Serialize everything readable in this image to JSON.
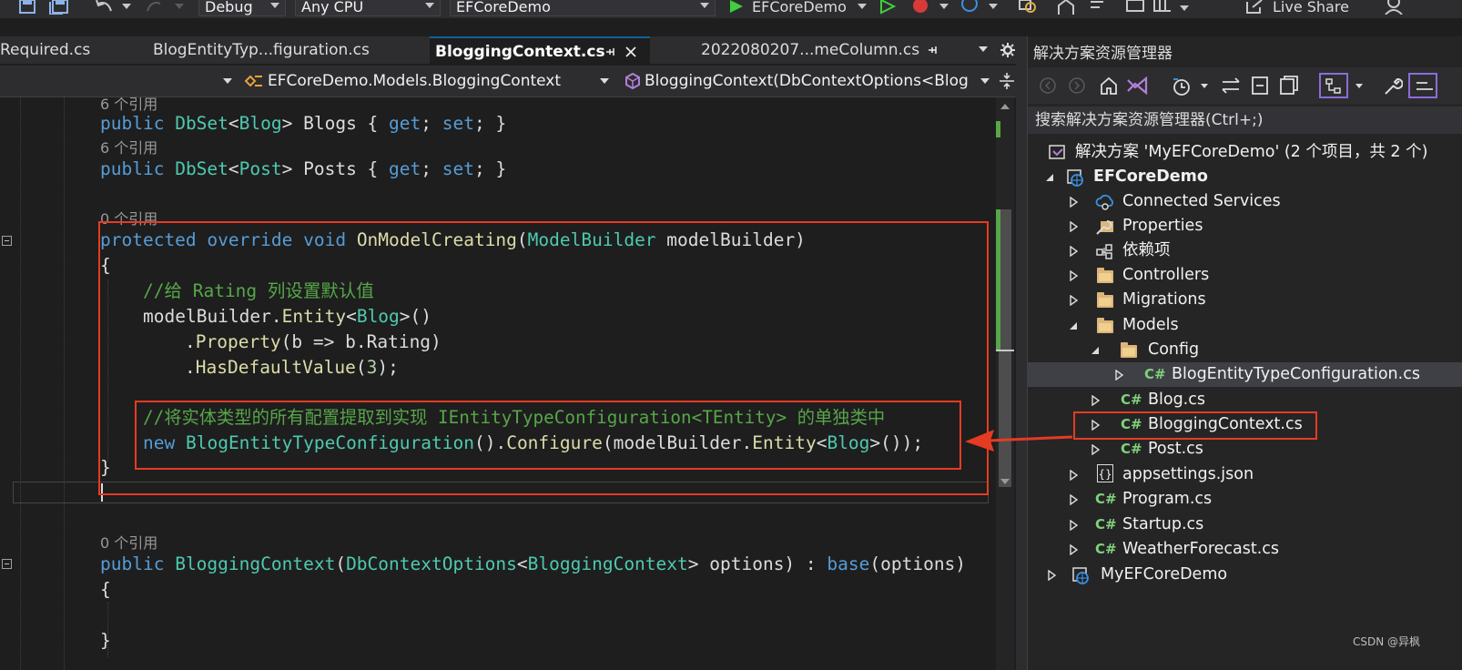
{
  "toolbar": {
    "config": "Debug",
    "platform": "Any CPU",
    "startup_project": "EFCoreDemo",
    "run_target": "EFCoreDemo",
    "live_share": "Live Share"
  },
  "tabs": [
    {
      "label": "Required.cs"
    },
    {
      "label": "BlogEntityTyp...figuration.cs"
    },
    {
      "label": "BloggingContext.cs",
      "active": true
    },
    {
      "label": "2022080207...meColumn.cs"
    }
  ],
  "navbar": {
    "class_path": "EFCoreDemo.Models.BloggingContext",
    "member": "BloggingContext(DbContextOptions<Blog"
  },
  "code": {
    "ref6a": "6 个引用",
    "blogs_line": {
      "kw": "public",
      "type": "DbSet",
      "lt": "<",
      "arg": "Blog",
      "gt": ">",
      "rest": " Blogs { ",
      "get": "get",
      "sep": "; ",
      "set": "set",
      "end": "; }"
    },
    "ref6b": "6 个引用",
    "posts_line": {
      "kw": "public",
      "type": "DbSet",
      "lt": "<",
      "arg": "Post",
      "gt": ">",
      "rest": " Posts { ",
      "get": "get",
      "sep": "; ",
      "set": "set",
      "end": "; }"
    },
    "ref0a": "0 个引用",
    "method_sig": {
      "kw1": "protected",
      "kw2": "override",
      "kw3": "void",
      "name": "OnModelCreating",
      "open": "(",
      "ptype": "ModelBuilder",
      "pname": " modelBuilder)"
    },
    "brace_open": "{",
    "comment1": "//给 Rating 列设置默认值",
    "entity_line": {
      "obj": "modelBuilder.",
      "method": "Entity",
      "lt": "<",
      "type": "Blog",
      "gt": ">",
      "end": "()"
    },
    "property_line": {
      "dot": ".",
      "method": "Property",
      "rest": "(b ",
      "arrow": "=>",
      "rest2": " b.Rating)"
    },
    "default_line": {
      "dot": ".",
      "method": "HasDefaultValue",
      "open": "(",
      "num": "3",
      "end": ");"
    },
    "comment2": "//将实体类型的所有配置提取到实现 IEntityTypeConfiguration<TEntity> 的单独类中",
    "new_line": {
      "kw": "new",
      "type": "BlogEntityTypeConfiguration",
      "mid": "().",
      "method": "Configure",
      "mid2": "(modelBuilder.",
      "method2": "Entity",
      "lt": "<",
      "type2": "Blog",
      "gt": ">",
      "end": "());"
    },
    "brace_close": "}",
    "ref0b": "0 个引用",
    "ctor_line": {
      "kw": "public",
      "name": "BloggingContext",
      "open": "(",
      "type": "DbContextOptions",
      "lt": "<",
      "arg": "BloggingContext",
      "gt": ">",
      "rest": " options) : ",
      "base": "base",
      "end": "(options)"
    },
    "ctor_open": "{",
    "ctor_close": "}"
  },
  "solution_explorer": {
    "title": "解决方案资源管理器",
    "search_placeholder": "搜索解决方案资源管理器(Ctrl+;)",
    "solution": "解决方案 'MyEFCoreDemo' (2 个项目，共 2 个)",
    "project": "EFCoreDemo",
    "items": {
      "connected": "Connected Services",
      "properties": "Properties",
      "deps": "依赖项",
      "controllers": "Controllers",
      "migrations": "Migrations",
      "models": "Models",
      "config": "Config",
      "blog_entity_cfg": "BlogEntityTypeConfiguration.cs",
      "blog": "Blog.cs",
      "bloggingcontext": "BloggingContext.cs",
      "post": "Post.cs",
      "appsettings": "appsettings.json",
      "program": "Program.cs",
      "startup": "Startup.cs",
      "weather": "WeatherForecast.cs",
      "project2": "MyEFCoreDemo"
    },
    "cs_badge": "C#",
    "json_badge": "{}"
  },
  "watermark": "CSDN @异枫",
  "colors": {
    "annotation": "#e53b23",
    "keyword": "#569cd6",
    "type": "#4ec9b0",
    "comment": "#57a64a",
    "method": "#dcdcaa"
  }
}
